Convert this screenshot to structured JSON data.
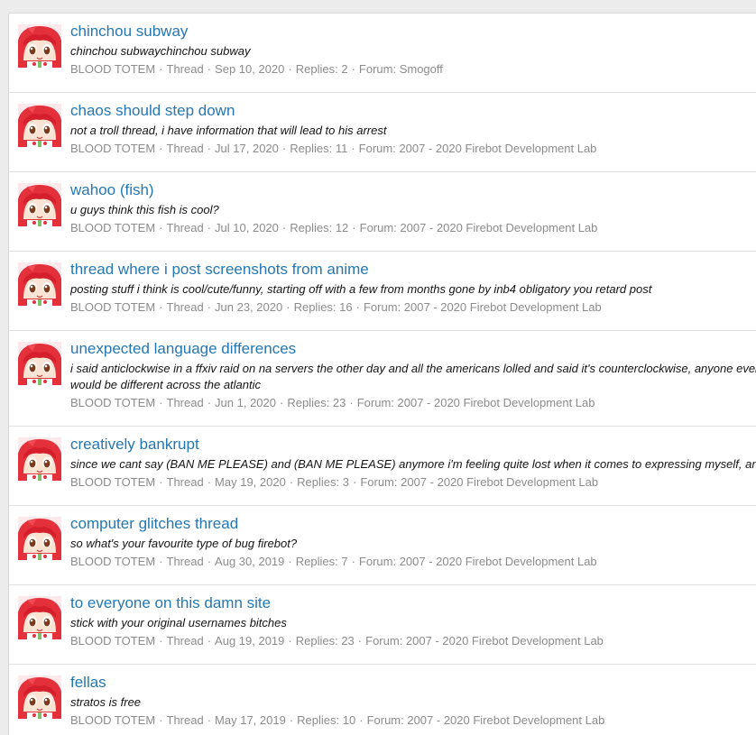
{
  "results": [
    {
      "title": "chinchou subway",
      "snippet": "chinchou subwaychinchou subway",
      "author": "BLOOD TOTEM",
      "type": "Thread",
      "date": "Sep 10, 2020",
      "replies": "Replies: 2",
      "forum": "Forum: Smogoff"
    },
    {
      "title": "chaos should step down",
      "snippet": "not a troll thread, i have information that will lead to his arrest",
      "author": "BLOOD TOTEM",
      "type": "Thread",
      "date": "Jul 17, 2020",
      "replies": "Replies: 11",
      "forum": "Forum: 2007 - 2020 Firebot Development Lab"
    },
    {
      "title": "wahoo (fish)",
      "snippet": "u guys think this fish is cool?",
      "author": "BLOOD TOTEM",
      "type": "Thread",
      "date": "Jul 10, 2020",
      "replies": "Replies: 12",
      "forum": "Forum: 2007 - 2020 Firebot Development Lab"
    },
    {
      "title": "thread where i post screenshots from anime",
      "snippet": "posting stuff i think is cool/cute/funny, starting off with a few from months gone by inb4 obligatory you retard post",
      "author": "BLOOD TOTEM",
      "type": "Thread",
      "date": "Jun 23, 2020",
      "replies": "Replies: 16",
      "forum": "Forum: 2007 - 2020 Firebot Development Lab"
    },
    {
      "title": "unexpected language differences",
      "snippet": "i said anticlockwise in a ffxiv raid on na servers the other day and all the americans lolled and said it's counterclockwise, anyone ever would be different across the atlantic",
      "author": "BLOOD TOTEM",
      "type": "Thread",
      "date": "Jun 1, 2020",
      "replies": "Replies: 23",
      "forum": "Forum: 2007 - 2020 Firebot Development Lab"
    },
    {
      "title": "creatively bankrupt",
      "snippet": "since we cant say (BAN ME PLEASE) and (BAN ME PLEASE) anymore i'm feeling quite lost when it comes to expressing myself, any",
      "author": "BLOOD TOTEM",
      "type": "Thread",
      "date": "May 19, 2020",
      "replies": "Replies: 3",
      "forum": "Forum: 2007 - 2020 Firebot Development Lab"
    },
    {
      "title": "computer glitches thread",
      "snippet": "so what's your favourite type of bug firebot?",
      "author": "BLOOD TOTEM",
      "type": "Thread",
      "date": "Aug 30, 2019",
      "replies": "Replies: 7",
      "forum": "Forum: 2007 - 2020 Firebot Development Lab"
    },
    {
      "title": "to everyone on this damn site",
      "snippet": "stick with your original usernames bitches",
      "author": "BLOOD TOTEM",
      "type": "Thread",
      "date": "Aug 19, 2019",
      "replies": "Replies: 23",
      "forum": "Forum: 2007 - 2020 Firebot Development Lab"
    },
    {
      "title": "fellas",
      "snippet": "stratos is free",
      "author": "BLOOD TOTEM",
      "type": "Thread",
      "date": "May 17, 2019",
      "replies": "Replies: 10",
      "forum": "Forum: 2007 - 2020 Firebot Development Lab"
    }
  ]
}
